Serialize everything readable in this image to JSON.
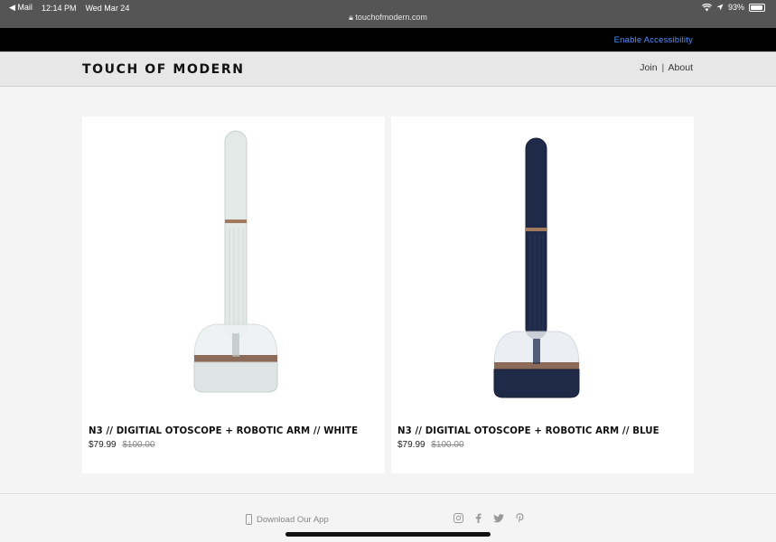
{
  "status_bar": {
    "back_app": "Mail",
    "time": "12:14 PM",
    "date": "Wed Mar 24",
    "url": "touchofmodern.com",
    "battery": "93%"
  },
  "accessibility": {
    "link": "Enable Accessibility"
  },
  "header": {
    "logo": "TOUCH OF MODERN",
    "join": "Join",
    "separator": "|",
    "about": "About"
  },
  "products": [
    {
      "title": "N3 // DIGITIAL OTOSCOPE + ROBOTIC ARM // WHITE",
      "price": "$79.99",
      "old_price": "$100.00",
      "color": "#e9eeec"
    },
    {
      "title": "N3 // DIGITIAL OTOSCOPE + ROBOTIC ARM // BLUE",
      "price": "$79.99",
      "old_price": "$100.00",
      "color": "#1f2a48"
    }
  ],
  "footer": {
    "app_link": "Download Our App",
    "socials": [
      "instagram-icon",
      "facebook-icon",
      "twitter-icon",
      "pinterest-icon"
    ]
  }
}
